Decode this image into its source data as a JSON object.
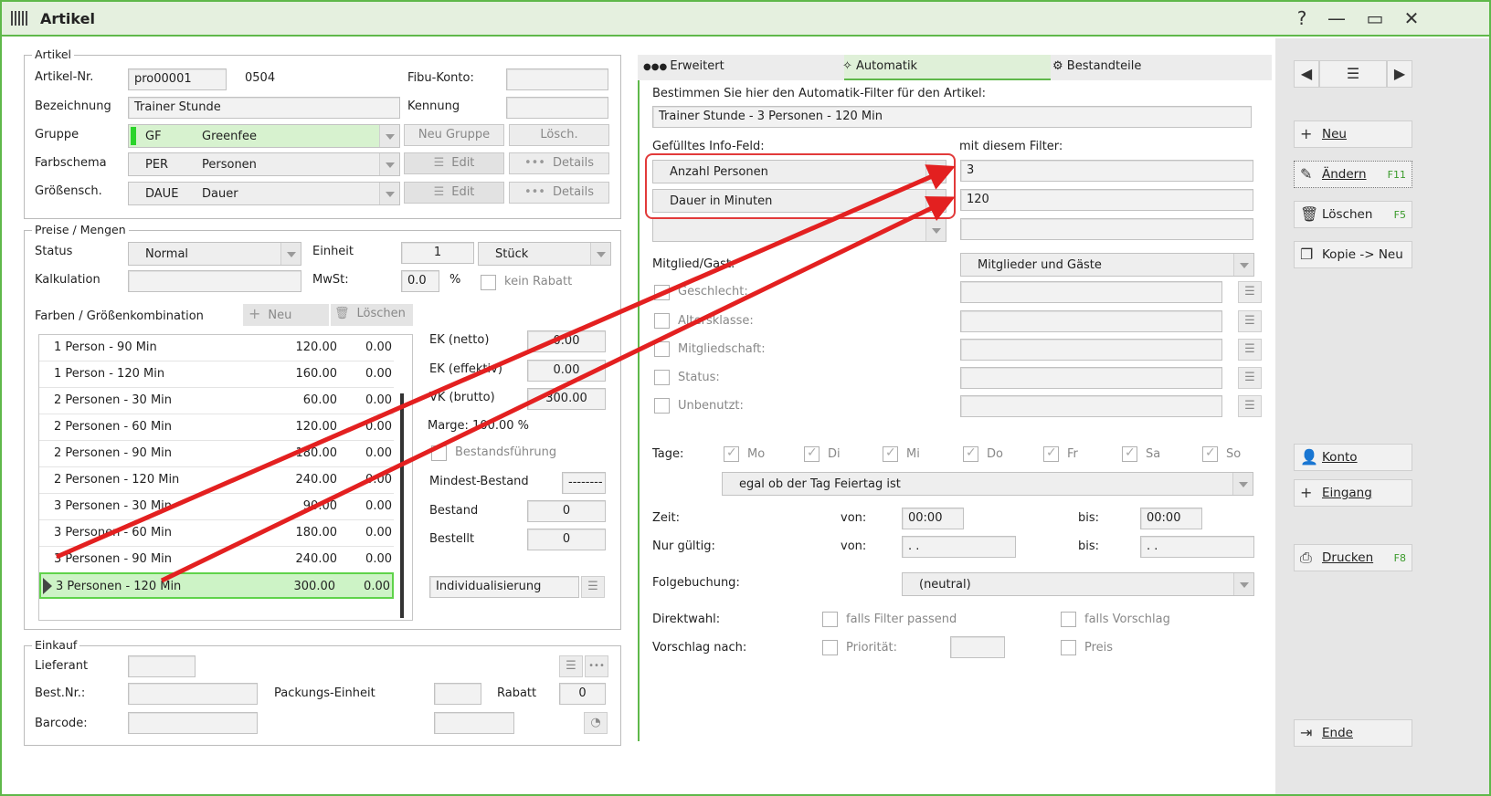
{
  "window": {
    "title": "Artikel",
    "help": "?",
    "minimize": "—",
    "maximize": "▭",
    "close": "✕"
  },
  "artikel": {
    "group_title": "Artikel",
    "nr_label": "Artikel-Nr.",
    "nr_value": "pro00001",
    "nr_extra": "0504",
    "fibu_label": "Fibu-Konto:",
    "fibu_value": "",
    "bez_label": "Bezeichnung",
    "bez_value": "Trainer Stunde",
    "kennung_label": "Kennung",
    "kennung_value": "",
    "gruppe_label": "Gruppe",
    "gruppe_code": "GF",
    "gruppe_name": "Greenfee",
    "neu_gruppe": "Neu Gruppe",
    "losch": "Lösch.",
    "farb_label": "Farbschema",
    "farb_code": "PER",
    "farb_name": "Personen",
    "edit": "Edit",
    "details": "Details",
    "groessen_label": "Größensch.",
    "groessen_code": "DAUE",
    "groessen_name": "Dauer"
  },
  "preise": {
    "group_title": "Preise / Mengen",
    "status_label": "Status",
    "status_value": "Normal",
    "einheit_label": "Einheit",
    "einheit_value": "1",
    "einheit_unit": "Stück",
    "kalk_label": "Kalkulation",
    "kalk_value": "",
    "mwst_label": "MwSt:",
    "mwst_value": "0.0",
    "pct": "%",
    "kein_rabatt": "kein Rabatt",
    "kombi_label": "Farben / Größenkombination",
    "neu": "Neu",
    "loeschen": "Löschen",
    "rows": [
      {
        "name": "1 Person - 90 Min",
        "price": "120.00",
        "disc": "0.00"
      },
      {
        "name": "1 Person - 120 Min",
        "price": "160.00",
        "disc": "0.00"
      },
      {
        "name": "2 Personen - 30 Min",
        "price": "60.00",
        "disc": "0.00"
      },
      {
        "name": "2 Personen - 60 Min",
        "price": "120.00",
        "disc": "0.00"
      },
      {
        "name": "2 Personen - 90 Min",
        "price": "180.00",
        "disc": "0.00"
      },
      {
        "name": "2 Personen - 120 Min",
        "price": "240.00",
        "disc": "0.00"
      },
      {
        "name": "3 Personen - 30 Min",
        "price": "90.00",
        "disc": "0.00"
      },
      {
        "name": "3 Personen - 60 Min",
        "price": "180.00",
        "disc": "0.00"
      },
      {
        "name": "3 Personen - 90 Min",
        "price": "240.00",
        "disc": "0.00"
      },
      {
        "name": "3 Personen - 120 Min",
        "price": "300.00",
        "disc": "0.00"
      }
    ],
    "ek_netto_label": "EK (netto)",
    "ek_netto": "0.00",
    "ek_eff_label": "EK (effektiv)",
    "ek_eff": "0.00",
    "vk_label": "VK (brutto)",
    "vk": "300.00",
    "marge": "Marge: 100.00 %",
    "bestandsf": "Bestandsführung",
    "mindest_label": "Mindest-Bestand",
    "mindest": "--------",
    "bestand_label": "Bestand",
    "bestand": "0",
    "bestellt_label": "Bestellt",
    "bestellt": "0",
    "individ": "Individualisierung"
  },
  "einkauf": {
    "group_title": "Einkauf",
    "lieferant": "Lieferant",
    "bestnr": "Best.Nr.:",
    "packung": "Packungs-Einheit",
    "rabatt": "Rabatt",
    "rabatt_value": "0",
    "barcode": "Barcode:"
  },
  "tabs": {
    "erweitert": "Erweitert",
    "automatik": "Automatik",
    "bestandteile": "Bestandteile"
  },
  "automatik": {
    "intro": "Bestimmen Sie hier den Automatik-Filter für den Artikel:",
    "filter_value": "Trainer Stunde - 3 Personen - 120 Min",
    "info_label": "Gefülltes Info-Feld:",
    "filter_label": "mit diesem Filter:",
    "info1": "Anzahl Personen",
    "filter1": "3",
    "info2": "Dauer in Minuten",
    "filter2": "120",
    "info3": "",
    "filter3": "",
    "mitglied_label": "Mitglied/Gast:",
    "mitglied_value": "Mitglieder und Gäste",
    "checks": [
      "Geschlecht:",
      "Altersklasse:",
      "Mitgliedschaft:",
      "Status:",
      "Unbenutzt:"
    ],
    "tage_label": "Tage:",
    "days": [
      "Mo",
      "Di",
      "Mi",
      "Do",
      "Fr",
      "Sa",
      "So"
    ],
    "feiertag": "egal ob der Tag Feiertag ist",
    "zeit_label": "Zeit:",
    "von": "von:",
    "bis": "bis:",
    "zeit_von": "00:00",
    "zeit_bis": "00:00",
    "gueltig_label": "Nur gültig:",
    "gueltig_von": ". .",
    "gueltig_bis": ". .",
    "folge_label": "Folgebuchung:",
    "folge_value": "(neutral)",
    "direkt_label": "Direktwahl:",
    "falls_filter": "falls Filter passend",
    "falls_vorschlag": "falls Vorschlag",
    "vorschlag_label": "Vorschlag nach:",
    "prioritaet": "Priorität:",
    "preis": "Preis"
  },
  "sidebar": {
    "neu": "Neu",
    "aendern": "Ändern",
    "aendern_key": "F11",
    "loeschen": "Löschen",
    "loeschen_key": "F5",
    "kopie": "Kopie -> Neu",
    "konto": "Konto",
    "eingang": "Eingang",
    "drucken": "Drucken",
    "drucken_key": "F8",
    "ende": "Ende"
  },
  "colors": {
    "accent": "#5fb84a",
    "highlight": "#e23a3a",
    "selected_row": "#cdf3c6"
  }
}
